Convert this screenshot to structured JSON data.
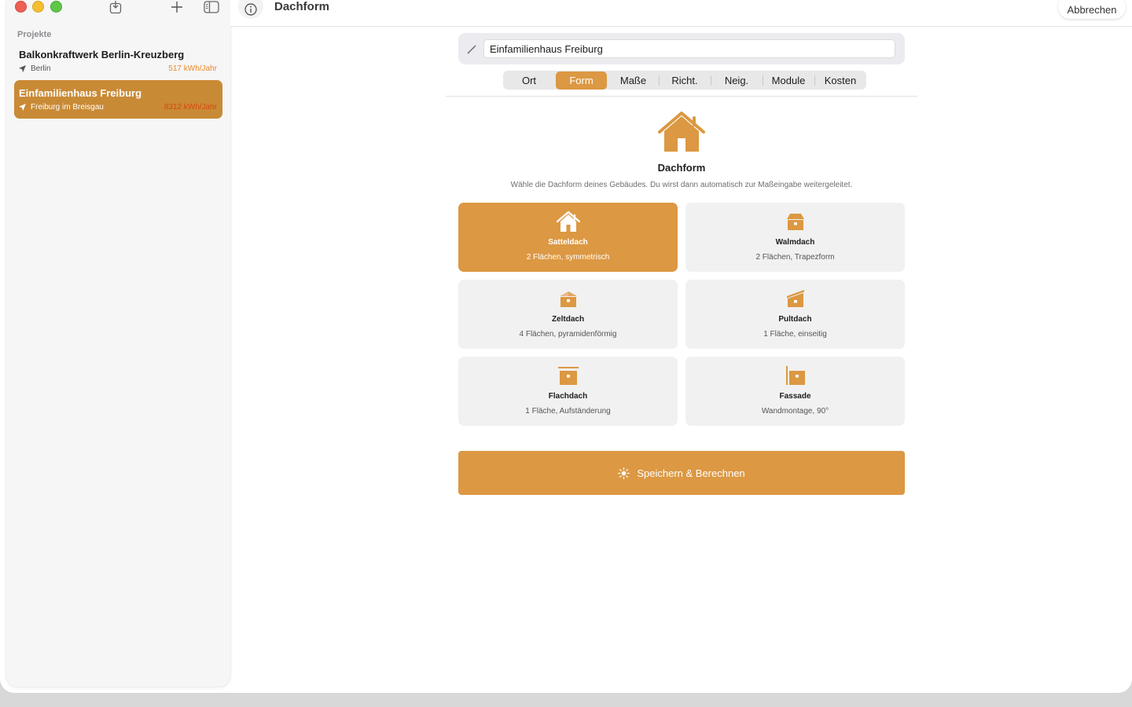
{
  "window": {
    "main_title": "Dachform"
  },
  "toolbar": {
    "cancel_label": "Abbrechen"
  },
  "sidebar": {
    "section_label": "Projekte",
    "projects": [
      {
        "name": "Balkonkraftwerk Berlin-Kreuzberg",
        "location": "Berlin",
        "yield": "517 kWh/Jahr",
        "selected": false
      },
      {
        "name": "Einfamilienhaus Freiburg",
        "location": "Freiburg im Breisgau",
        "yield": "8312 kWh/Jahr",
        "selected": true
      }
    ]
  },
  "project_name": {
    "value": "Einfamilienhaus Freiburg"
  },
  "tabs": [
    {
      "label": "Ort",
      "active": false
    },
    {
      "label": "Form",
      "active": true
    },
    {
      "label": "Maße",
      "active": false
    },
    {
      "label": "Richt.",
      "active": false
    },
    {
      "label": "Neig.",
      "active": false
    },
    {
      "label": "Module",
      "active": false
    },
    {
      "label": "Kosten",
      "active": false
    }
  ],
  "hero": {
    "title": "Dachform",
    "description": "Wähle die Dachform deines Gebäudes. Du wirst dann automatisch zur Maßeingabe weitergeleitet."
  },
  "roof_types": [
    {
      "title": "Satteldach",
      "subtitle": "2 Flächen, symmetrisch",
      "icon": "gable-roof-icon",
      "selected": true
    },
    {
      "title": "Walmdach",
      "subtitle": "2 Flächen, Trapezform",
      "icon": "hip-roof-icon",
      "selected": false
    },
    {
      "title": "Zeltdach",
      "subtitle": "4 Flächen, pyramidenförmig",
      "icon": "pyramid-roof-icon",
      "selected": false
    },
    {
      "title": "Pultdach",
      "subtitle": "1 Fläche, einseitig",
      "icon": "shed-roof-icon",
      "selected": false
    },
    {
      "title": "Flachdach",
      "subtitle": "1 Fläche, Aufständerung",
      "icon": "flat-roof-icon",
      "selected": false
    },
    {
      "title": "Fassade",
      "subtitle": "Wandmontage, 90°",
      "icon": "facade-icon",
      "selected": false
    }
  ],
  "save_button": {
    "label": "Speichern & Berechnen",
    "icon": "sun-icon"
  },
  "colors": {
    "accent": "#dc9842",
    "sidebar_selected": "#c98a35",
    "yield_text": "#e8892c"
  }
}
